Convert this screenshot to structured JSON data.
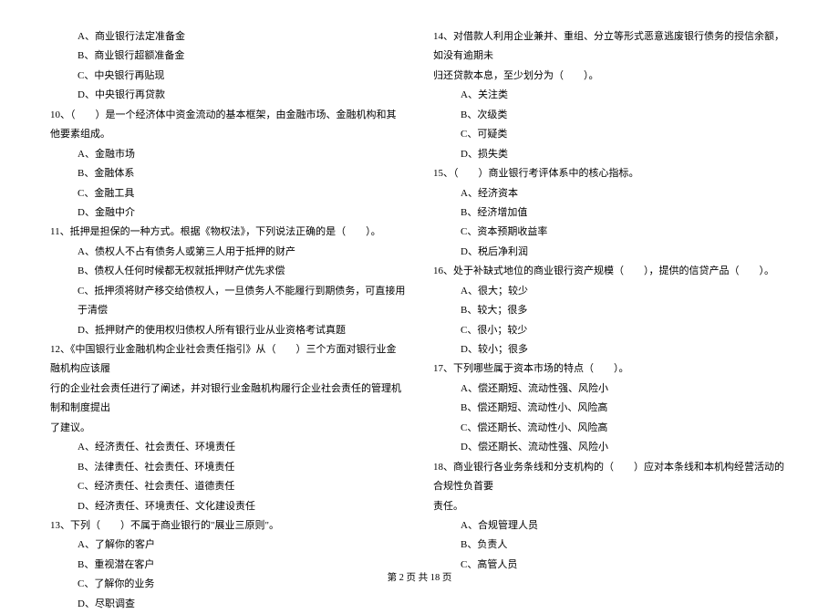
{
  "left": {
    "opts_9": [
      "A、商业银行法定准备金",
      "B、商业银行超额准备金",
      "C、中央银行再贴现",
      "D、中央银行再贷款"
    ],
    "q10": "10、（　　）是一个经济体中资金流动的基本框架，由金融市场、金融机构和其他要素组成。",
    "opts_10": [
      "A、金融市场",
      "B、金融体系",
      "C、金融工具",
      "D、金融中介"
    ],
    "q11": "11、抵押是担保的一种方式。根据《物权法》，下列说法正确的是（　　）。",
    "opts_11": [
      "A、债权人不占有债务人或第三人用于抵押的财产",
      "B、债权人任何时候都无权就抵押财产优先求偿",
      "C、抵押须将财产移交给债权人，一旦债务人不能履行到期债务，可直接用于清偿",
      "D、抵押财产的使用权归债权人所有银行业从业资格考试真题"
    ],
    "q12": "12、《中国银行业金融机构企业社会责任指引》从（　　）三个方面对银行业金融机构应该履",
    "q12_cont1": "行的企业社会责任进行了阐述，并对银行业金融机构履行企业社会责任的管理机制和制度提出",
    "q12_cont2": "了建议。",
    "opts_12": [
      "A、经济责任、社会责任、环境责任",
      "B、法律责任、社会责任、环境责任",
      "C、经济责任、社会责任、道德责任",
      "D、经济责任、环境责任、文化建设责任"
    ],
    "q13": "13、下列（　　）不属于商业银行的\"展业三原则\"。",
    "opts_13": [
      "A、了解你的客户",
      "B、重视潜在客户",
      "C、了解你的业务",
      "D、尽职调查"
    ]
  },
  "right": {
    "q14": "14、对借款人利用企业兼并、重组、分立等形式恶意逃废银行债务的授信余额，如没有逾期未",
    "q14_cont": "归还贷款本息，至少划分为（　　）。",
    "opts_14": [
      "A、关注类",
      "B、次级类",
      "C、可疑类",
      "D、损失类"
    ],
    "q15": "15、（　　）商业银行考评体系中的核心指标。",
    "opts_15": [
      "A、经济资本",
      "B、经济增加值",
      "C、资本预期收益率",
      "D、税后净利润"
    ],
    "q16": "16、处于补缺式地位的商业银行资产规模（　　），提供的信贷产品（　　）。",
    "opts_16": [
      "A、很大；较少",
      "B、较大；很多",
      "C、很小；较少",
      "D、较小；很多"
    ],
    "q17": "17、下列哪些属于资本市场的特点（　　）。",
    "opts_17": [
      "A、偿还期短、流动性强、风险小",
      "B、偿还期短、流动性小、风险高",
      "C、偿还期长、流动性小、风险高",
      "D、偿还期长、流动性强、风险小"
    ],
    "q18": "18、商业银行各业务条线和分支机构的（　　）应对本条线和本机构经营活动的合规性负首要",
    "q18_cont": "责任。",
    "opts_18": [
      "A、合规管理人员",
      "B、负责人",
      "C、高管人员"
    ]
  },
  "footer": "第 2 页 共 18 页"
}
